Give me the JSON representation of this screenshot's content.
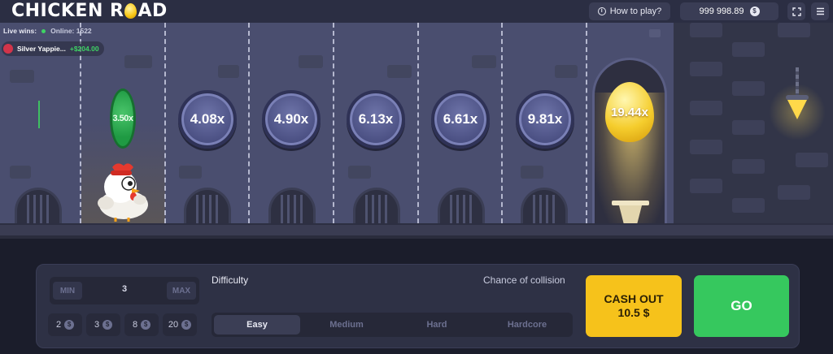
{
  "header": {
    "logo_left": "CHICKEN R",
    "logo_right": "AD",
    "how_to_play": "How to play?",
    "balance": "999 998.89",
    "currency_symbol": "$"
  },
  "live": {
    "label": "Live wins:",
    "online_label": "Online:",
    "online_count": "1522",
    "winner_name": "Silver Yappie...",
    "winner_amount": "+$204.00"
  },
  "lanes": {
    "passed_multiplier": "3.50x",
    "multipliers": [
      "4.08x",
      "4.90x",
      "6.13x",
      "6.61x",
      "9.81x"
    ],
    "final_multiplier": "19.44x"
  },
  "controls": {
    "min_label": "MIN",
    "max_label": "MAX",
    "bet_value": "3",
    "quick_bets": [
      "2",
      "3",
      "8",
      "20"
    ],
    "difficulty_label": "Difficulty",
    "chance_label": "Chance of collision",
    "difficulties": [
      "Easy",
      "Medium",
      "Hard",
      "Hardcore"
    ],
    "selected_difficulty": "Easy",
    "cashout_label": "CASH OUT",
    "cashout_amount": "10.5 $",
    "go_label": "GO"
  },
  "colors": {
    "accent_yellow": "#f6c21b",
    "accent_green": "#36c85e",
    "panel_bg": "#2e3145",
    "scene_bg": "#4a4e6f"
  }
}
